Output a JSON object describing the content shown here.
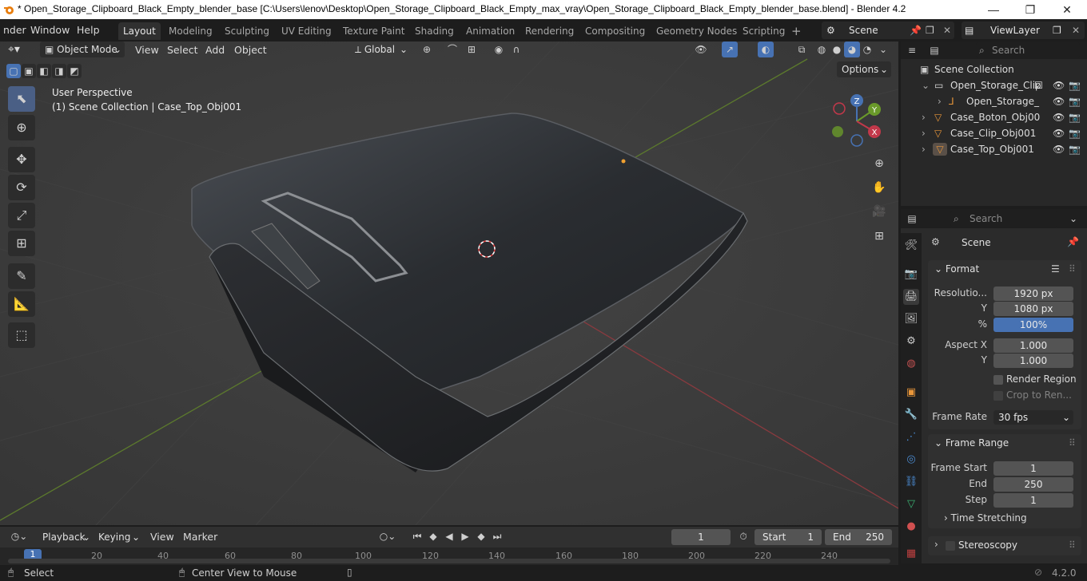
{
  "titlebar": {
    "title": "* Open_Storage_Clipboard_Black_Empty_blender_base [C:\\Users\\lenov\\Desktop\\Open_Storage_Clipboard_Black_Empty_max_vray\\Open_Storage_Clipboard_Black_Empty_blender_base.blend] - Blender 4.2",
    "minimize": "—",
    "maximize": "❐",
    "close": "✕"
  },
  "menu": [
    "nder",
    "Window",
    "Help"
  ],
  "workspaces": [
    "Layout",
    "Modeling",
    "Sculpting",
    "UV Editing",
    "Texture Paint",
    "Shading",
    "Animation",
    "Rendering",
    "Compositing",
    "Geometry Nodes",
    "Scripting"
  ],
  "workspace_add": "+",
  "scene_name": "Scene",
  "view_layer": "ViewLayer",
  "viewport": {
    "mode": "Object Mode",
    "menus": [
      "View",
      "Select",
      "Add",
      "Object"
    ],
    "orientation": "Global",
    "options_label": "Options",
    "overlay_line1": "User Perspective",
    "overlay_line2": "(1) Scene Collection | Case_Top_Obj001",
    "axes": {
      "z": "Z",
      "y": "Y",
      "x": "X"
    }
  },
  "outliner": {
    "search_placeholder": "Search",
    "root": "Scene Collection",
    "rows": [
      {
        "label": "Open_Storage_Clip"
      },
      {
        "label": "Open_Storage_"
      },
      {
        "label": "Case_Boton_Obj00"
      },
      {
        "label": "Case_Clip_Obj001"
      },
      {
        "label": "Case_Top_Obj001"
      }
    ]
  },
  "properties": {
    "search_placeholder": "Search",
    "context": "Scene",
    "format": {
      "title": "Format",
      "resolution_label": "Resolutio...",
      "res_x": "1920 px",
      "y_label": "Y",
      "res_y": "1080 px",
      "percent_label": "%",
      "percent": "100%",
      "aspect_x_label": "Aspect X",
      "aspect_x": "1.000",
      "aspect_y_label": "Y",
      "aspect_y": "1.000",
      "render_region": "Render Region",
      "crop": "Crop to Ren...",
      "frame_rate_label": "Frame Rate",
      "frame_rate": "30 fps"
    },
    "frame_range": {
      "title": "Frame Range",
      "start_label": "Frame Start",
      "start": "1",
      "end_label": "End",
      "end": "250",
      "step_label": "Step",
      "step": "1"
    },
    "time_stretching": "Time Stretching",
    "stereoscopy": "Stereoscopy"
  },
  "timeline": {
    "menus": [
      "Playback",
      "Keying",
      "View",
      "Marker"
    ],
    "current_frame": "1",
    "start_label": "Start",
    "start": "1",
    "end_label": "End",
    "end": "250",
    "ruler": [
      "1",
      "20",
      "40",
      "60",
      "80",
      "100",
      "120",
      "140",
      "160",
      "180",
      "200",
      "220",
      "240"
    ]
  },
  "statusbar": {
    "select": "Select",
    "center_view": "Center View to Mouse",
    "version": "4.2.0"
  }
}
